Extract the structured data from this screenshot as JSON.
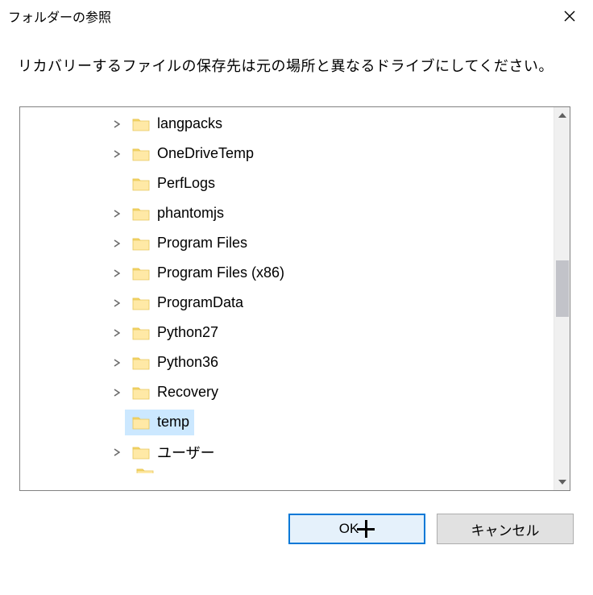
{
  "titlebar": {
    "title": "フォルダーの参照"
  },
  "instruction": "リカバリーするファイルの保存先は元の場所と異なるドライブにしてください。",
  "tree": {
    "items": [
      {
        "label": "langpacks",
        "expandable": true,
        "selected": false
      },
      {
        "label": "OneDriveTemp",
        "expandable": true,
        "selected": false
      },
      {
        "label": "PerfLogs",
        "expandable": false,
        "selected": false
      },
      {
        "label": "phantomjs",
        "expandable": true,
        "selected": false
      },
      {
        "label": "Program Files",
        "expandable": true,
        "selected": false
      },
      {
        "label": "Program Files (x86)",
        "expandable": true,
        "selected": false
      },
      {
        "label": "ProgramData",
        "expandable": true,
        "selected": false
      },
      {
        "label": "Python27",
        "expandable": true,
        "selected": false
      },
      {
        "label": "Python36",
        "expandable": true,
        "selected": false
      },
      {
        "label": "Recovery",
        "expandable": true,
        "selected": false
      },
      {
        "label": "temp",
        "expandable": false,
        "selected": true
      },
      {
        "label": "ユーザー",
        "expandable": true,
        "selected": false
      }
    ]
  },
  "buttons": {
    "ok": "OK",
    "cancel": "キャンセル"
  },
  "icons": {
    "close": "close",
    "chevron_right": "›",
    "scroll_up": "▴",
    "scroll_down": "▾"
  }
}
